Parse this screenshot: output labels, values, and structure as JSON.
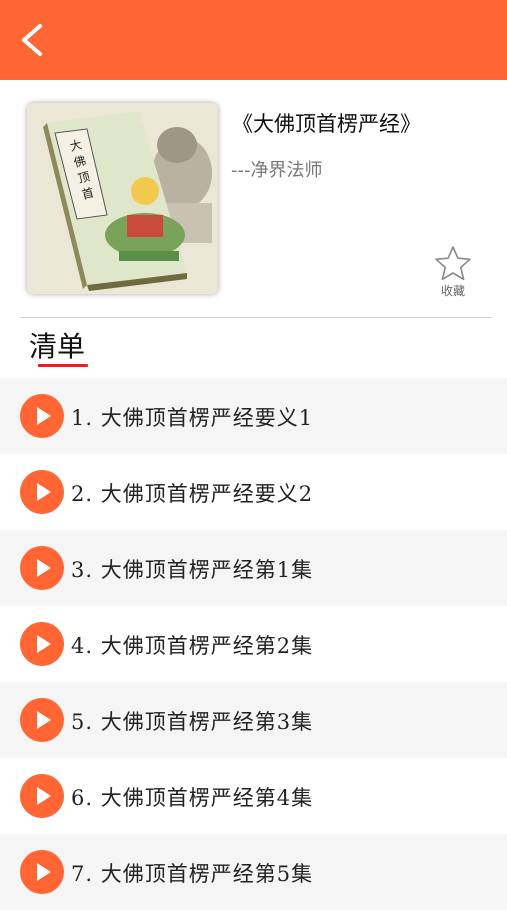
{
  "header": {
    "back_icon": "chevron-left-icon",
    "background_color": "#ff6633"
  },
  "album": {
    "title": "《大佛顶首楞严经》",
    "author": "---净界法师",
    "favorite_label": "收藏",
    "cover_icon": "book-cover-image"
  },
  "list": {
    "heading": "清单",
    "underline_color": "#e8231c",
    "items": [
      {
        "label": "1.  大佛顶首楞严经要义1"
      },
      {
        "label": "2.  大佛顶首楞严经要义2"
      },
      {
        "label": "3.  大佛顶首楞严经第1集"
      },
      {
        "label": "4.  大佛顶首楞严经第2集"
      },
      {
        "label": "5.  大佛顶首楞严经第3集"
      },
      {
        "label": "6.  大佛顶首楞严经第4集"
      },
      {
        "label": "7.  大佛顶首楞严经第5集"
      }
    ]
  },
  "colors": {
    "accent": "#ff6633",
    "row_alt": "#f5f5f5"
  }
}
